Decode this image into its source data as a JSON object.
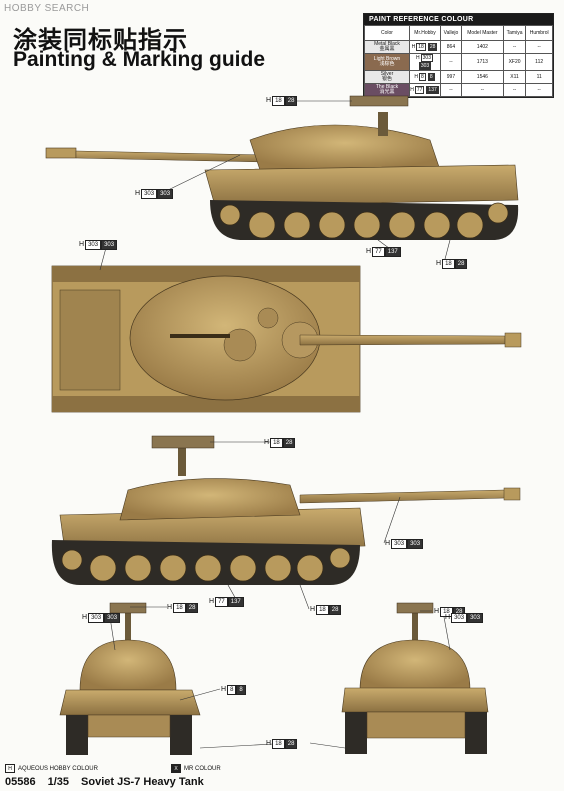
{
  "watermark": "HOBBY SEARCH",
  "title_cn": "涂装同标贴指示",
  "title_en": "Painting & Marking guide",
  "paint_table": {
    "heading": "PAINT REFERENCE COLOUR",
    "columns": [
      "Color",
      "Mr.Hobby",
      "Vallejo",
      "Model Master",
      "Tamiya",
      "Humbrol"
    ],
    "rows": [
      {
        "color_en": "Metal Black",
        "color_cn": "金属黑",
        "swatch": "#e8e8e8",
        "dark_text": true,
        "hobby_h": "H",
        "hobby_code1": "18",
        "hobby_code2": "28",
        "vallejo": "864",
        "model_master": "1402",
        "tamiya": "--",
        "humbrol": "--"
      },
      {
        "color_en": "Light Brown",
        "color_cn": "浅棕色",
        "swatch": "#8a6a4f",
        "dark_text": false,
        "hobby_h": "H",
        "hobby_code1": "303",
        "hobby_code2": "303",
        "vallejo": "--",
        "model_master": "1713",
        "tamiya": "XF20",
        "humbrol": "112"
      },
      {
        "color_en": "Silver",
        "color_cn": "银色",
        "swatch": "#e8e8e8",
        "dark_text": true,
        "hobby_h": "H",
        "hobby_code1": "8",
        "hobby_code2": "8",
        "vallejo": "997",
        "model_master": "1546",
        "tamiya": "X11",
        "humbrol": "11"
      },
      {
        "color_en": "The Black",
        "color_cn": "消光黑",
        "swatch": "#6a4d63",
        "dark_text": false,
        "hobby_h": "H",
        "hobby_code1": "77",
        "hobby_code2": "137",
        "vallejo": "--",
        "model_master": "--",
        "tamiya": "--",
        "humbrol": "--"
      }
    ]
  },
  "callouts": [
    {
      "id": "side1_mg",
      "h": "H",
      "a": "18",
      "b": "28"
    },
    {
      "id": "side1_hull",
      "h": "H",
      "a": "303",
      "b": "303"
    },
    {
      "id": "side1_track",
      "h": "H",
      "a": "77",
      "b": "137"
    },
    {
      "id": "side1_wheel",
      "h": "H",
      "a": "18",
      "b": "28"
    },
    {
      "id": "top_hull",
      "h": "H",
      "a": "303",
      "b": "303"
    },
    {
      "id": "side2_mg",
      "h": "H",
      "a": "18",
      "b": "28"
    },
    {
      "id": "side2_hull",
      "h": "H",
      "a": "303",
      "b": "303"
    },
    {
      "id": "side2_track",
      "h": "H",
      "a": "77",
      "b": "137"
    },
    {
      "id": "side2_wheel",
      "h": "H",
      "a": "18",
      "b": "28"
    },
    {
      "id": "front_hull",
      "h": "H",
      "a": "303",
      "b": "303"
    },
    {
      "id": "front_mg",
      "h": "H",
      "a": "18",
      "b": "28"
    },
    {
      "id": "front_light",
      "h": "H",
      "a": "8",
      "b": "8"
    },
    {
      "id": "rear_mg",
      "h": "H",
      "a": "18",
      "b": "28"
    },
    {
      "id": "rear_hull",
      "h": "H",
      "a": "303",
      "b": "303"
    },
    {
      "id": "bottom_track",
      "h": "H",
      "a": "18",
      "b": "28"
    }
  ],
  "legend": [
    {
      "box": "H",
      "label": "AQUEOUS HOBBY COLOUR",
      "dark": false
    },
    {
      "box": "X",
      "label": "MR COLOUR",
      "dark": true
    }
  ],
  "footer": {
    "code": "05586",
    "scale": "1/35",
    "name": "Soviet JS-7 Heavy Tank"
  },
  "colors": {
    "tank_sand": "#b89a5d",
    "tank_shadow": "#8c7142",
    "tank_dark": "#5a4528",
    "track": "#2a2a2a",
    "wheel": "#b89a5d"
  }
}
